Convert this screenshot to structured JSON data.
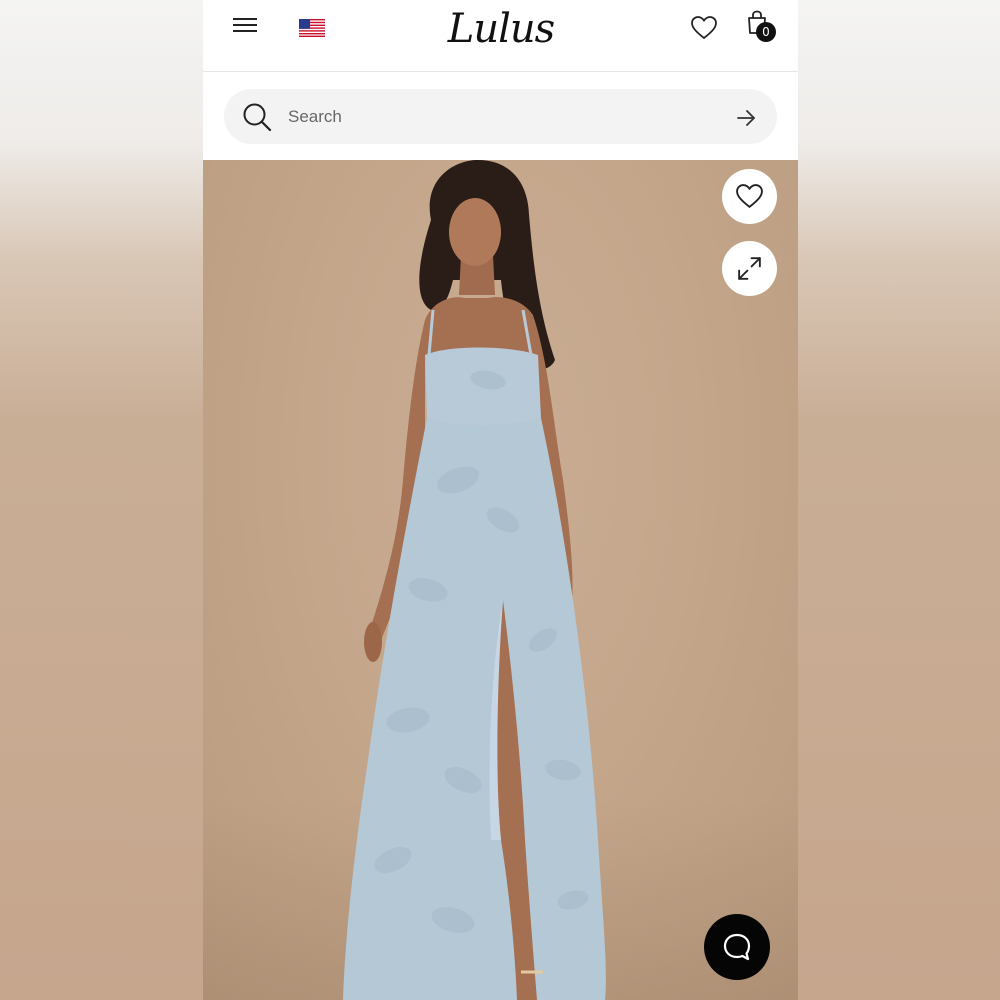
{
  "brand": {
    "logo_text": "Lulus"
  },
  "header": {
    "cart_count": "0"
  },
  "search": {
    "placeholder": "Search"
  },
  "icons": {
    "menu": "hamburger-menu-icon",
    "flag": "us-flag-icon",
    "wishlist": "heart-outline-icon",
    "cart": "shopping-bag-icon",
    "search": "magnifier-icon",
    "submit": "arrow-right-icon",
    "favorite": "heart-outline-icon",
    "expand": "expand-arrows-icon",
    "chat": "chat-bubble-icon"
  },
  "colors": {
    "chat_button": "#050505",
    "photo_backdrop": "#c4a68b",
    "dress": "#b8cad8"
  }
}
